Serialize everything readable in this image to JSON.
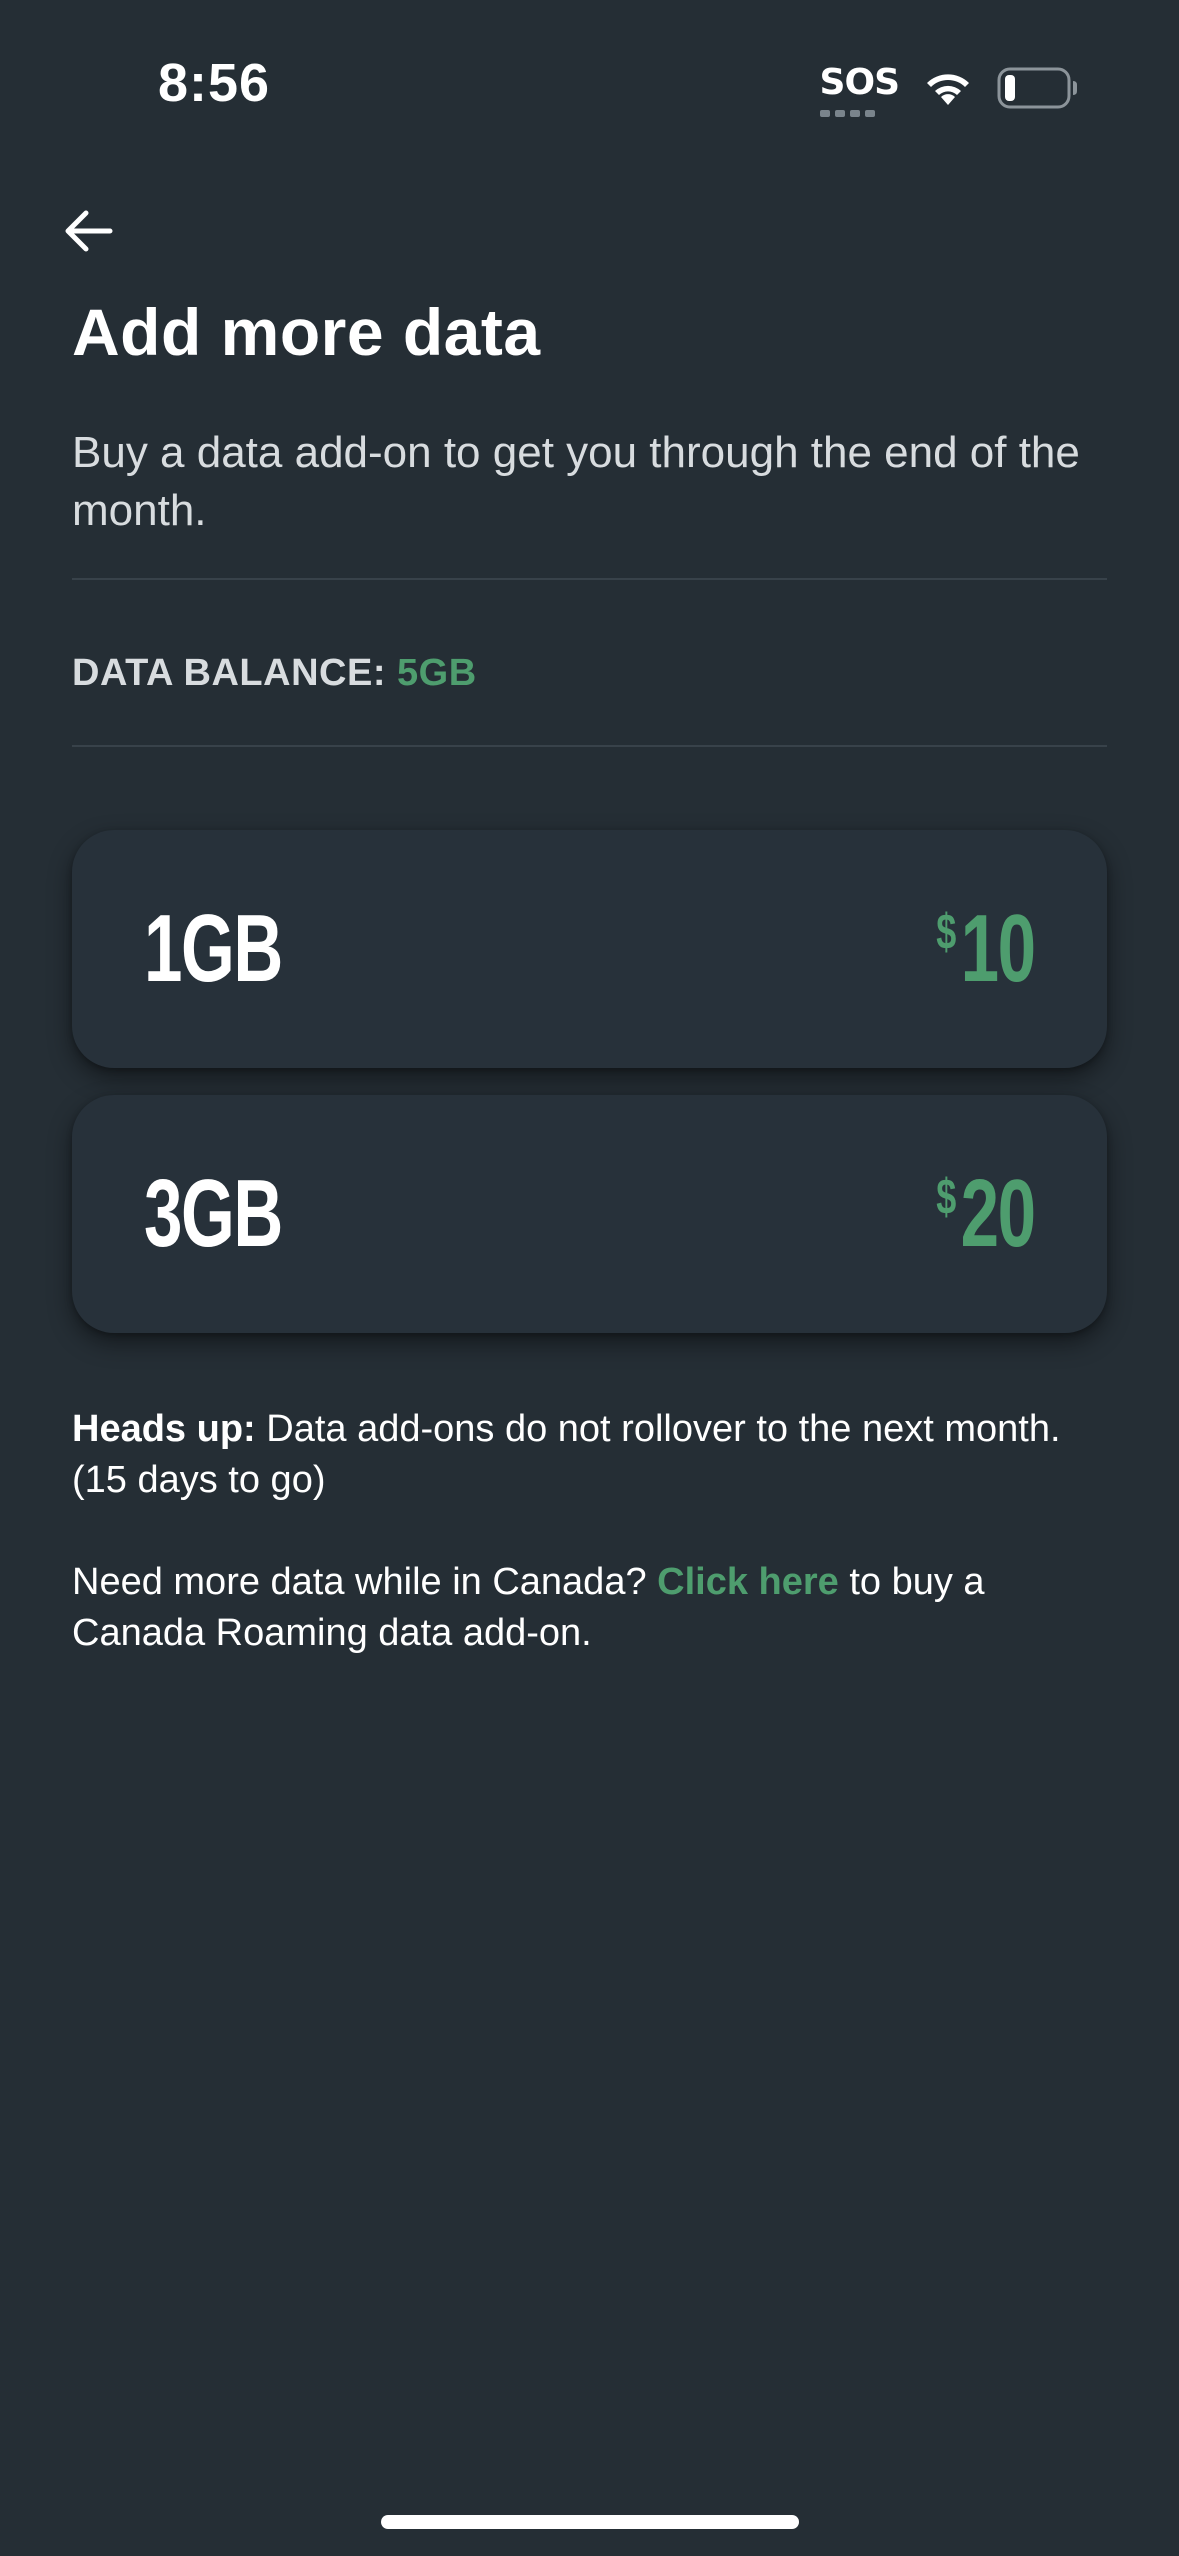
{
  "status_bar": {
    "time": "8:56",
    "sos": "SOS",
    "icons": [
      "wifi-icon",
      "battery-icon"
    ],
    "battery_level": 0.12
  },
  "header": {
    "back_icon": "arrow-left-icon",
    "title": "Add more data",
    "subtitle": "Buy a data add-on to get you through the end of the month."
  },
  "balance": {
    "label": "DATA BALANCE:",
    "value": "5GB"
  },
  "addons": [
    {
      "size": "1GB",
      "currency": "$",
      "amount": "10"
    },
    {
      "size": "3GB",
      "currency": "$",
      "amount": "20"
    }
  ],
  "notices": {
    "heads_up_label": "Heads up:",
    "heads_up_text": " Data add-ons do not rollover to the next month. (15 days to go)",
    "canada_prefix": "Need more data while in Canada? ",
    "canada_link": "Click here",
    "canada_suffix": " to buy a Canada Roaming data add-on."
  },
  "colors": {
    "background": "#252e35",
    "card": "#27313a",
    "accent_green": "#4e9d6e",
    "text_primary": "#ffffff",
    "text_secondary": "#d8dcdf",
    "divider": "#38424a"
  }
}
